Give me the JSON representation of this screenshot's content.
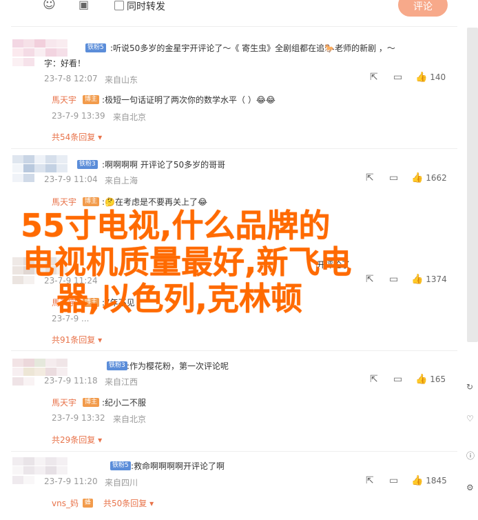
{
  "toolbar": {
    "emoji_icon": "smile-icon",
    "image_icon": "image-icon",
    "forward_label": "同时转发",
    "comment_label": "评论"
  },
  "colors": {
    "accent": "#e8734a",
    "overlay": "#ff6a00",
    "badge_blue": "#5b8dd9",
    "badge_orange": "#f29b4b"
  },
  "comments": [
    {
      "badge": "铁粉5",
      "text": "听说50多岁的金星宇开评论了～《 寄生虫》全剧组都在追🐎老师的新剧 ，～",
      "text2": "字：好看！",
      "time": "23-7-8 12:07",
      "loc": "来自山东",
      "likes": "140",
      "reply": {
        "name": "馬天宇",
        "badge": "博主",
        "text": "极短一句话证明了两次你的数学水平（ ）😂😂",
        "time": "23-7-9 13:39",
        "loc": "来自北京"
      },
      "expand": "共54条回复"
    },
    {
      "badge": "铁粉3",
      "text": "啊啊啊啊 开评论了50多岁的哥哥",
      "time": "23-7-9 11:04",
      "loc": "来自上海",
      "likes": "1662",
      "reply": {
        "name": "馬天宇",
        "badge": "博主",
        "text": "🤔在考虑是不要再关上了😂",
        "time": "",
        "loc": ""
      },
      "expand": ""
    },
    {
      "badge": "",
      "text": "开评论了",
      "time": "23-7-9 11:24",
      "loc": "",
      "likes": "1374",
      "reply": {
        "name": "馬天宇",
        "badge": "博主",
        "text": "7年不见",
        "time": "23-7-9 ...",
        "loc": ""
      },
      "expand": "共91条回复"
    },
    {
      "badge": "铁粉3",
      "text": "作为樱花粉，第一次评论呢",
      "time": "23-7-9 11:18",
      "loc": "来自江西",
      "likes": "165",
      "reply": {
        "name": "馬天宇",
        "badge": "博主",
        "text": "纪小二不服",
        "time": "23-7-9 13:32",
        "loc": "来自北京"
      },
      "expand": "共29条回复"
    },
    {
      "badge": "铁粉5",
      "text": "救命啊啊啊啊开评论了啊",
      "time": "23-7-9 11:20",
      "loc": "来自四川",
      "likes": "1845",
      "reply": {
        "name": "vns_妈",
        "badge": "",
        "text": "共50条回复",
        "time": "",
        "loc": ""
      },
      "expand": ""
    }
  ],
  "overlay_title": {
    "line1": "55寸电视,什么品牌的",
    "line2": "电视机质量最好,新飞电",
    "line3": "器,以色列,克林顿"
  },
  "icons": {
    "share": "share-icon",
    "comment": "comment-icon",
    "like": "like-icon"
  }
}
